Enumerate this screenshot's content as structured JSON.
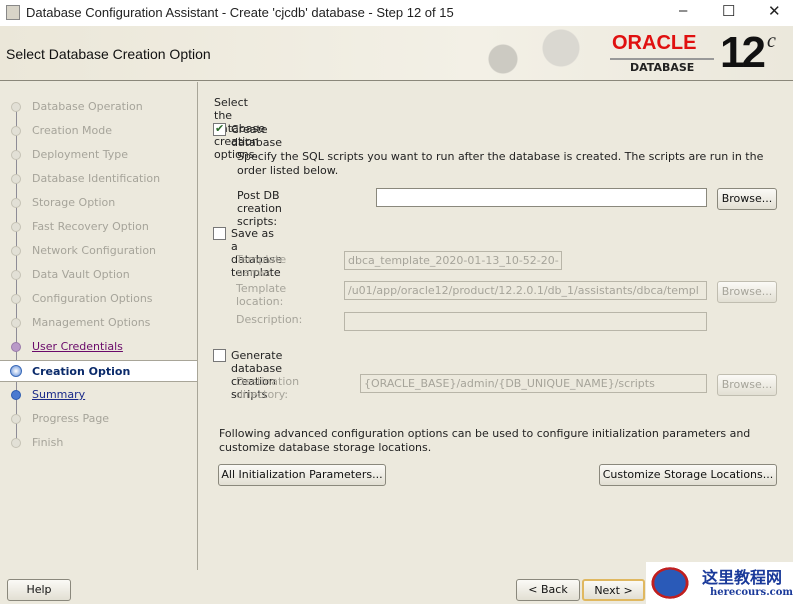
{
  "window": {
    "title": "Database Configuration Assistant - Create 'cjcdb' database - Step 12 of 15",
    "minimize": "–",
    "maximize": "☐",
    "close": "✕"
  },
  "header": {
    "title": "Select Database Creation Option",
    "brand": "ORACLE",
    "product": "DATABASE",
    "version": "12",
    "version_sup": "c"
  },
  "sidebar": {
    "items": [
      {
        "label": "Database Operation"
      },
      {
        "label": "Creation Mode"
      },
      {
        "label": "Deployment Type"
      },
      {
        "label": "Database Identification"
      },
      {
        "label": "Storage Option"
      },
      {
        "label": "Fast Recovery Option"
      },
      {
        "label": "Network Configuration"
      },
      {
        "label": "Data Vault Option"
      },
      {
        "label": "Configuration Options"
      },
      {
        "label": "Management Options"
      },
      {
        "label": "User Credentials"
      },
      {
        "label": "Creation Option"
      },
      {
        "label": "Summary"
      },
      {
        "label": "Progress Page"
      },
      {
        "label": "Finish"
      }
    ]
  },
  "main": {
    "intro": "Select the database creation options.",
    "create_db": {
      "label": "Create database",
      "checked": true
    },
    "scripts_desc": "Specify the SQL scripts you want to run after the database is created. The scripts are run in the order listed below.",
    "post_label": "Post DB creation scripts:",
    "post_value": "",
    "browse": "Browse...",
    "save_template": {
      "label": "Save as a database template",
      "checked": false
    },
    "template_name_label": "Template name:",
    "template_name_value": "dbca_template_2020-01-13_10-52-20-",
    "template_location_label": "Template location:",
    "template_location_value": "/u01/app/oracle12/product/12.2.0.1/db_1/assistants/dbca/templ",
    "description_label": "Description:",
    "description_value": "",
    "gen_scripts": {
      "label": "Generate database creation scripts",
      "checked": false
    },
    "dest_label": "Destination directory:",
    "dest_value": "{ORACLE_BASE}/admin/{DB_UNIQUE_NAME}/scripts",
    "advanced_text": "Following advanced configuration options can be used to configure initialization parameters and customize database storage locations.",
    "init_params": "All Initialization Parameters...",
    "storage": "Customize Storage Locations..."
  },
  "footer": {
    "help": "Help",
    "back": "< Back",
    "next": "Next >"
  },
  "watermark": {
    "text": "这里教程网",
    "url": "herecours.com"
  }
}
